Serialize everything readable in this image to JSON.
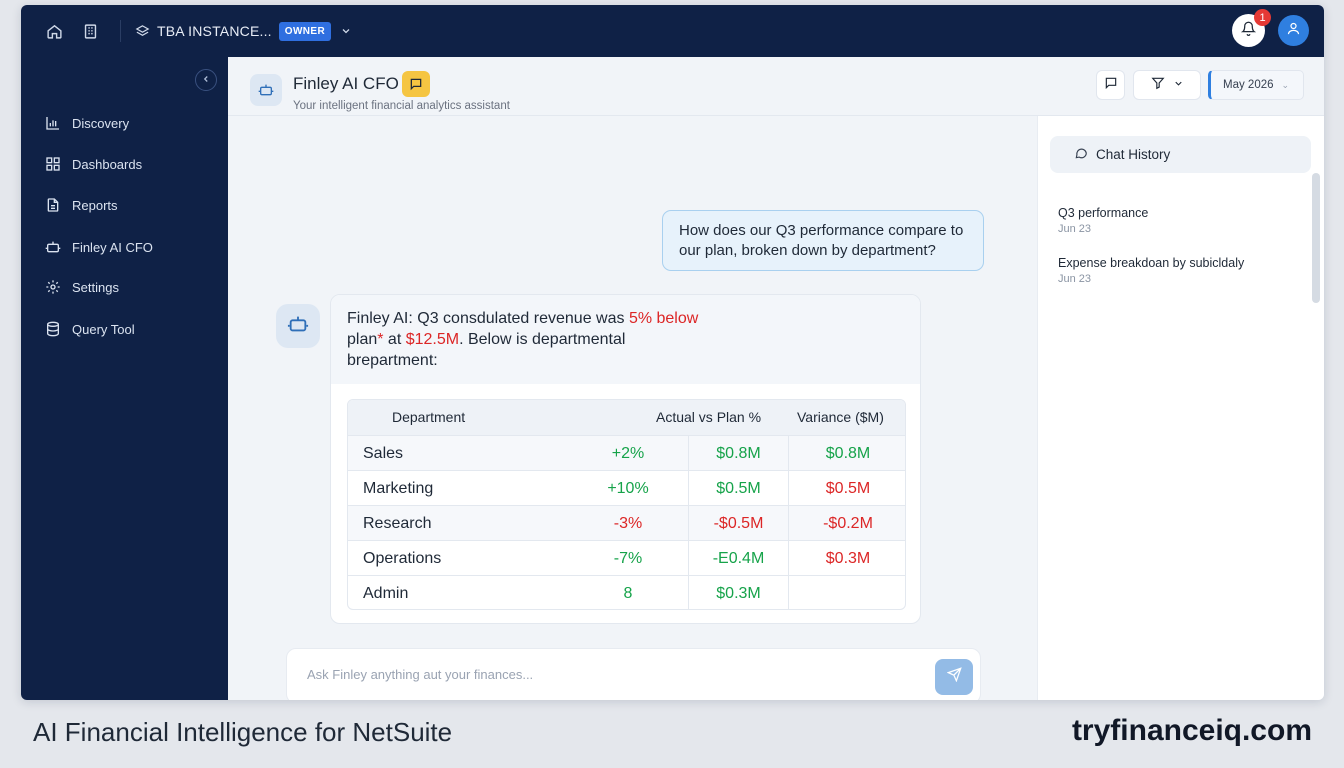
{
  "topbar": {
    "instance_name": "TBA INSTANCE...",
    "role_badge": "OWNER",
    "notification_count": "1"
  },
  "sidebar": {
    "items": [
      {
        "label": "Discovery",
        "icon": "bar-chart-icon"
      },
      {
        "label": "Dashboards",
        "icon": "grid-icon"
      },
      {
        "label": "Reports",
        "icon": "document-icon"
      },
      {
        "label": "Finley AI CFO",
        "icon": "bot-icon"
      },
      {
        "label": "Settings",
        "icon": "gear-icon"
      },
      {
        "label": "Query Tool",
        "icon": "database-icon"
      }
    ]
  },
  "header": {
    "title": "Finley AI CFO",
    "subtitle": "Your intelligent financial analytics assistant",
    "date_filter": "May 2026"
  },
  "chat": {
    "user_message": "How does our Q3 performance compare to our plan, broken down by department?",
    "bot_intro_a": "Finley AI: Q3 consdulated revenue was ",
    "bot_intro_highlight": "5% below",
    "bot_intro_b": "plan",
    "bot_intro_star": "*",
    "bot_intro_c": " at ",
    "bot_intro_amount": "$12.5M",
    "bot_intro_d": ". Below is departmental",
    "bot_intro_e": "brepartment:",
    "table": {
      "headers": [
        "Department",
        "Actual vs Plan %",
        "Variance ($M)"
      ],
      "rows": [
        {
          "department": "Sales",
          "pct": "+2%",
          "actual": "$0.8M",
          "variance": "$0.8M"
        },
        {
          "department": "Marketing",
          "pct": "+10%",
          "actual": "$0.5M",
          "variance": "$0.5M"
        },
        {
          "department": "Research",
          "pct": "-3%",
          "actual": "-$0.5M",
          "variance": "-$0.2M"
        },
        {
          "department": "Operations",
          "pct": "-7%",
          "actual": "-E0.4M",
          "variance": "$0.3M"
        },
        {
          "department": "Admin",
          "pct": "8",
          "actual": "$0.3M",
          "variance": ""
        }
      ]
    },
    "input_placeholder": "Ask Finley anything aut your finances..."
  },
  "history": {
    "button_label": "Chat History",
    "items": [
      {
        "title": "Q3 performance",
        "date": "Jun 23"
      },
      {
        "title": "Expense breakdoan by subicldaly",
        "date": "Jun 23"
      }
    ]
  },
  "caption": {
    "left": "AI Financial Intelligence for NetSuite",
    "right": "tryfinanceiq.com"
  },
  "colors": {
    "navy": "#0f2146",
    "accent_blue": "#2f7fe0",
    "positive": "#16a34a",
    "negative": "#dc2626",
    "chip_yellow": "#f5c542"
  }
}
